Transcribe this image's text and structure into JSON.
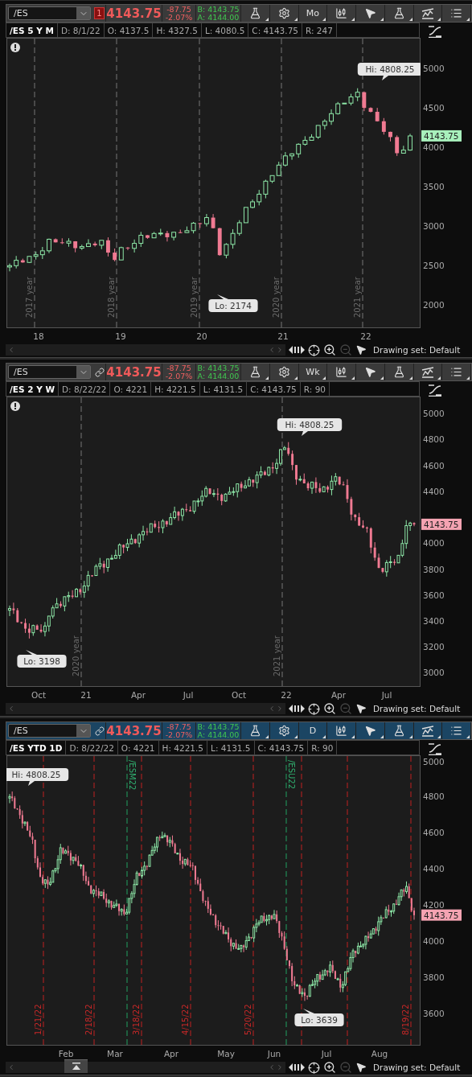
{
  "panels": [
    {
      "symbol": "/ES",
      "link": {
        "kind": "badge",
        "text": "1"
      },
      "last": "4143.75",
      "change": "-87.75",
      "change_pct": "-2.07%",
      "bid": "B: 4143.75",
      "ask": "A: 4144.00",
      "period": "Mo",
      "active": false,
      "title": "/ES 5 Y M",
      "fields": [
        "D: 8/1/22",
        "O: 4137.5",
        "H: 4327.5",
        "L: 4080.5",
        "C: 4143.75",
        "R: 247"
      ],
      "alert": true,
      "price_tag": {
        "text": "4143.75",
        "color": "#a8f0bc"
      },
      "yticks": [
        "5000",
        "4500",
        "4000",
        "3500",
        "3000",
        "2500",
        "2000"
      ],
      "markers": [
        {
          "kind": "period",
          "label": "2017 year"
        },
        {
          "kind": "period",
          "label": "2018 year"
        },
        {
          "kind": "period",
          "label": "2019 year"
        },
        {
          "kind": "period",
          "label": "2020 year"
        },
        {
          "kind": "period",
          "label": "2021 year"
        }
      ],
      "callouts": [
        {
          "kind": "high",
          "text": "Hi: 4808.25"
        },
        {
          "kind": "low",
          "text": "Lo: 2174"
        }
      ],
      "xlabels": [
        "18",
        "19",
        "20",
        "21",
        "22"
      ],
      "collapse_button": false,
      "drawing_set": "Drawing set: Default"
    },
    {
      "symbol": "/ES",
      "link": {
        "kind": "chain"
      },
      "last": "4143.75",
      "change": "-87.75",
      "change_pct": "-2.07%",
      "bid": "B: 4143.75",
      "ask": "A: 4144.00",
      "period": "Wk",
      "active": false,
      "title": "/ES 2 Y W",
      "fields": [
        "D: 8/22/22",
        "O: 4221",
        "H: 4221.5",
        "L: 4131.5",
        "C: 4143.75",
        "R: 90"
      ],
      "alert": true,
      "price_tag": {
        "text": "4143.75",
        "color": "#f4a3b2"
      },
      "yticks": [
        "5000",
        "4800",
        "4600",
        "4400",
        "4000",
        "3800",
        "3600",
        "3400",
        "3200",
        "3000"
      ],
      "markers": [
        {
          "kind": "period",
          "label": "2020 year"
        },
        {
          "kind": "period",
          "label": "2021 year"
        }
      ],
      "callouts": [
        {
          "kind": "high",
          "text": "Hi: 4808.25"
        },
        {
          "kind": "low",
          "text": "Lo: 3198"
        }
      ],
      "xlabels": [
        "Oct",
        "21",
        "Apr",
        "Jul",
        "Oct",
        "22",
        "Apr",
        "Jul"
      ],
      "collapse_button": false,
      "drawing_set": "Drawing set: Default"
    },
    {
      "symbol": "/ES",
      "link": {
        "kind": "chain"
      },
      "last": "4143.75",
      "change": "-87.75",
      "change_pct": "-2.07%",
      "bid": "B: 4143.75",
      "ask": "A: 4144.00",
      "period": "D",
      "active": true,
      "title": "/ES YTD 1D",
      "fields": [
        "D: 8/22/22",
        "O: 4221",
        "H: 4221.5",
        "L: 4131.5",
        "C: 4143.75",
        "R: 90"
      ],
      "alert": false,
      "price_tag": {
        "text": "4143.75",
        "color": "#f4a3b2"
      },
      "yticks": [
        "5000",
        "4800",
        "4600",
        "4400",
        "4200",
        "4000",
        "3800",
        "3600"
      ],
      "markers": [
        {
          "kind": "date",
          "label": "1/21/22"
        },
        {
          "kind": "date",
          "label": "2/18/22"
        },
        {
          "kind": "expiry",
          "label": "/ESM22"
        },
        {
          "kind": "date",
          "label": "3/18/22"
        },
        {
          "kind": "date",
          "label": "4/15/22"
        },
        {
          "kind": "date",
          "label": "5/20/22"
        },
        {
          "kind": "expiry",
          "label": "/ESU22"
        },
        {
          "kind": "date"
        },
        {
          "kind": "date"
        },
        {
          "kind": "date",
          "label": "8/19/22"
        }
      ],
      "callouts": [
        {
          "kind": "high",
          "text": "Hi: 4808.25"
        },
        {
          "kind": "low",
          "text": "Lo: 3639"
        }
      ],
      "xlabels": [
        "Feb",
        "Mar",
        "Apr",
        "May",
        "Jun",
        "Jul",
        "Aug"
      ],
      "collapse_button": true,
      "drawing_set": "Drawing set: Default"
    }
  ]
}
